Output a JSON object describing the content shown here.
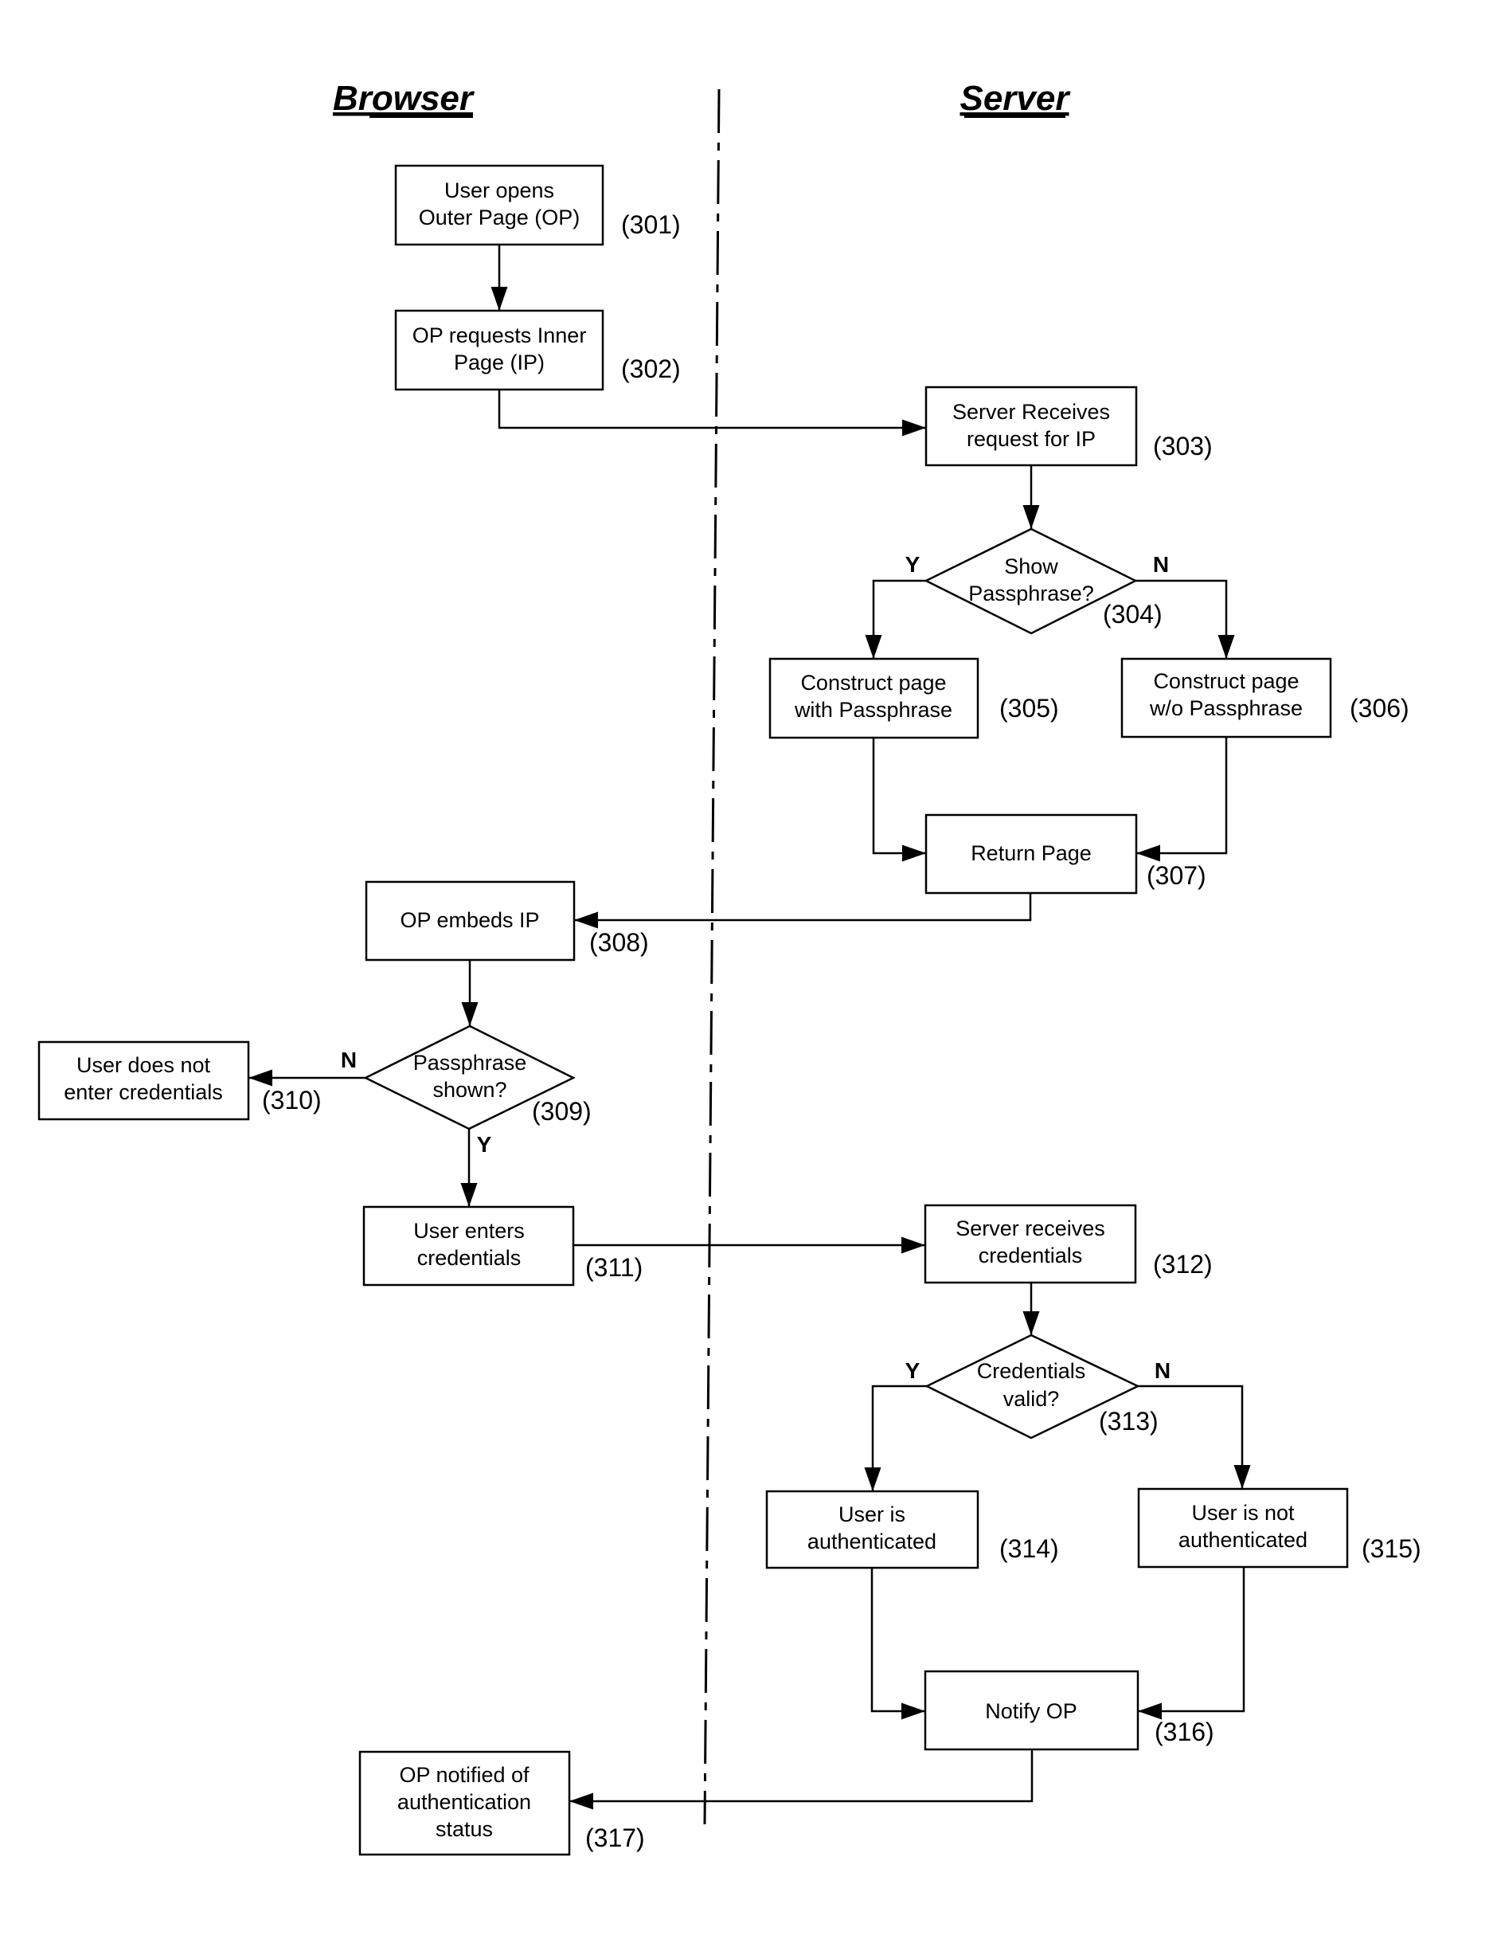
{
  "lanes": {
    "browser": "Browser",
    "server": "Server"
  },
  "steps": {
    "s301": {
      "ref": "(301)",
      "lines": [
        "User opens",
        "Outer Page (OP)"
      ]
    },
    "s302": {
      "ref": "(302)",
      "lines": [
        "OP requests Inner",
        "Page (IP)"
      ]
    },
    "s303": {
      "ref": "(303)",
      "lines": [
        "Server Receives",
        "request for IP"
      ]
    },
    "s304": {
      "ref": "(304)",
      "lines": [
        "Show",
        "Passphrase?"
      ],
      "yes": "Y",
      "no": "N"
    },
    "s305": {
      "ref": "(305)",
      "lines": [
        "Construct page",
        "with Passphrase"
      ]
    },
    "s306": {
      "ref": "(306)",
      "lines": [
        "Construct page",
        "w/o Passphrase"
      ]
    },
    "s307": {
      "ref": "(307)",
      "lines": [
        "Return Page"
      ]
    },
    "s308": {
      "ref": "(308)",
      "lines": [
        "OP embeds IP"
      ]
    },
    "s309": {
      "ref": "(309)",
      "lines": [
        "Passphrase",
        "shown?"
      ],
      "yes": "Y",
      "no": "N"
    },
    "s310": {
      "ref": "(310)",
      "lines": [
        "User does not",
        "enter credentials"
      ]
    },
    "s311": {
      "ref": "(311)",
      "lines": [
        "User enters",
        "credentials"
      ]
    },
    "s312": {
      "ref": "(312)",
      "lines": [
        "Server receives",
        "credentials"
      ]
    },
    "s313": {
      "ref": "(313)",
      "lines": [
        "Credentials",
        "valid?"
      ],
      "yes": "Y",
      "no": "N"
    },
    "s314": {
      "ref": "(314)",
      "lines": [
        "User is",
        "authenticated"
      ]
    },
    "s315": {
      "ref": "(315)",
      "lines": [
        "User is not",
        "authenticated"
      ]
    },
    "s316": {
      "ref": "(316)",
      "lines": [
        "Notify OP"
      ]
    },
    "s317": {
      "ref": "(317)",
      "lines": [
        "OP notified of",
        "authentication",
        "status"
      ]
    }
  }
}
